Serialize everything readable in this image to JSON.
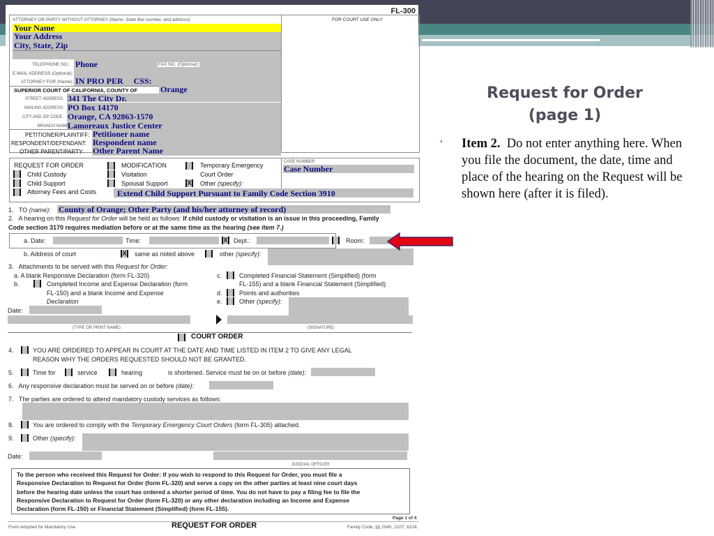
{
  "slide": {
    "title_line1": "Request for Order",
    "title_line2": "(page 1)",
    "bullet_bold": "Item 2.",
    "bullet_text": "Do not enter anything here. When you file the document, the date, time and place of the hearing on the Request will be shown here (after it is filed).",
    "arrow_color": "#e30613",
    "theme": {
      "dark": "#434557",
      "teal": "#4a8584",
      "light": "#a6c1c3",
      "title": "#4c4e5c",
      "bullet": "#9a5fb0"
    }
  },
  "form": {
    "form_number": "FL-300",
    "attorney_label": "ATTORNEY OR PARTY WITHOUT ATTORNEY",
    "attorney_label_italic": "(Name, State Bar number, and address):",
    "court_use_only": "FOR COURT USE ONLY",
    "name": "Your Name",
    "address": "Your Address",
    "city_state_zip": "City, State, Zip",
    "telephone_label": "TELEPHONE NO.:",
    "telephone": "Phone",
    "fax_label": "FAX NO.",
    "fax_label_italic": "(Optional):",
    "email_label": "E-MAIL ADDRESS (Optional):",
    "attorney_for_label": "ATTORNEY FOR (Name):",
    "attorney_for": "IN PRO PER     CSS:",
    "court_label": "SUPERIOR COURT OF CALIFORNIA, COUNTY OF",
    "county": "Orange",
    "street_label": "STREET ADDRESS:",
    "street": "341 The City Dr.",
    "mailing_label": "MAILING ADDRESS:",
    "mailing": "PO Box 14170",
    "city_zip_label": "CITY AND ZIP CODE:",
    "city_zip": "Orange, CA  92863-1570",
    "branch_label": "BRANCH NAME:",
    "branch": "Lamoreaux Justice Center",
    "petitioner_label": "PETITIONER/PLAINTIFF:",
    "petitioner": "Petitioner name",
    "respondent_label": "RESPONDENT/DEFENDANT:",
    "respondent": "Respondent name",
    "other_parent_label": "OTHER PARENT/PARTY:",
    "other_parent": "Other Parent Name",
    "request_heading": "REQUEST FOR ORDER",
    "case_number_label": "CASE NUMBER:",
    "case_number": "Case Number",
    "request_options": [
      {
        "label": "Child Custody",
        "checked": false
      },
      {
        "label": "Child Support",
        "checked": false
      },
      {
        "label": "Attorney Fees and Costs",
        "checked": false
      },
      {
        "label": "MODIFICATION",
        "checked": false
      },
      {
        "label": "Visitation",
        "checked": false
      },
      {
        "label": "Spousal Support",
        "checked": false
      },
      {
        "label": "Temporary Emergency",
        "label2": "Court Order",
        "checked": false
      },
      {
        "label": "Other",
        "label_italic": "(specify):",
        "checked": true
      }
    ],
    "other_specify": "Extend Child Support Pursuant to Family Code Section 3910",
    "item1_num": "1.",
    "item1_label": "TO",
    "item1_label_italic": "(name):",
    "item1_value": "County of Orange; Other Party (and his/her attorney of record)",
    "item2_num": "2.",
    "item2_text_a": "A hearing on this",
    "item2_text_i": "Request for Order",
    "item2_text_b": "will be held as follows:",
    "item2_bold_1": "If child custody or visitation is an issue in this proceeding, Family",
    "item2_bold_2": "Code section 3170 requires mediation before or at the same time as the hearing",
    "item2_bold_italic": "(see item 7.)",
    "hearing": {
      "date_label": "a. Date:",
      "time_label": "Time:",
      "dept_label": "Dept.:",
      "dept_checked": true,
      "room_label": "Room:",
      "room_checked": false,
      "address_label": "b. Address of court",
      "same_label": "same as noted above",
      "same_checked": true,
      "other_label": "other",
      "other_label_italic": "(specify):",
      "other_checked": false
    },
    "item3": {
      "num": "3.",
      "text": "Attachments to be served with this",
      "text_italic": "Request for Order:",
      "a": "a.  A blank Responsive Declaration (form FL-320)",
      "b_1": "Completed Income and Expense Declaration (form",
      "b_2": "FL-150) and a blank Income and Expense",
      "b_3": "Declaration",
      "c_1": "Completed Financial Statement (Simplified) (form",
      "c_2": "FL-155) and a blank Financial Statement (Simplified)",
      "d": "Points and authorities",
      "e": "Other",
      "e_italic": "(specify):"
    },
    "date_label": "Date:",
    "type_name_label": "(TYPE OR PRINT NAME)",
    "signature_label": "(SIGNATURE)",
    "court_order_heading": "COURT ORDER",
    "item4_num": "4.",
    "item4_line1": "YOU ARE ORDERED TO APPEAR IN COURT AT THE DATE AND TIME LISTED IN ITEM 2 TO GIVE ANY LEGAL",
    "item4_line2": "REASON WHY THE ORDERS REQUESTED SHOULD NOT BE GRANTED.",
    "item5_num": "5.",
    "item5_time_for": "Time for",
    "item5_service": "service",
    "item5_hearing": "hearing",
    "item5_rest": "is shortened. Service must be on or before",
    "item5_rest_italic": "(date):",
    "item6_num": "6.",
    "item6_text": "Any responsive declaration must be served on or before",
    "item6_italic": "(date):",
    "item7_num": "7.",
    "item7_text": "The parties are ordered to attend mandatory custody services as follows:",
    "item8_num": "8.",
    "item8_text_a": "You are ordered to comply with the",
    "item8_italic": "Temporary Emergency Court Orders",
    "item8_text_b": "(form FL-305) attached.",
    "item9_num": "9.",
    "item9_text": "Other",
    "item9_italic": "(specify):",
    "judicial_officer": "JUDICIAL OFFICER",
    "notice_1": "To the person who received this Request for Order: If you wish to respond to this Request for Order, you must file a",
    "notice_2": "Responsive Declaration to Request for Order (form FL-320) and serve a copy on the other parties at least nine court days",
    "notice_3": "before the hearing date unless the court has ordered a shorter period of time. You do not have to pay a filing fee to file the",
    "notice_4": "Responsive Declaration to Request for Order (form FL-320) or any other declaration including an Income and Expense",
    "notice_5": "Declaration (form FL-150) or Financial Statement (Simplified) (form FL-155).",
    "page_label": "Page 1 of 4",
    "footer_left": "Form Adopted for Mandatory Use",
    "footer_title": "REQUEST FOR ORDER",
    "footer_right": "Family Code, §§ 2045, 2107, 6224,"
  }
}
